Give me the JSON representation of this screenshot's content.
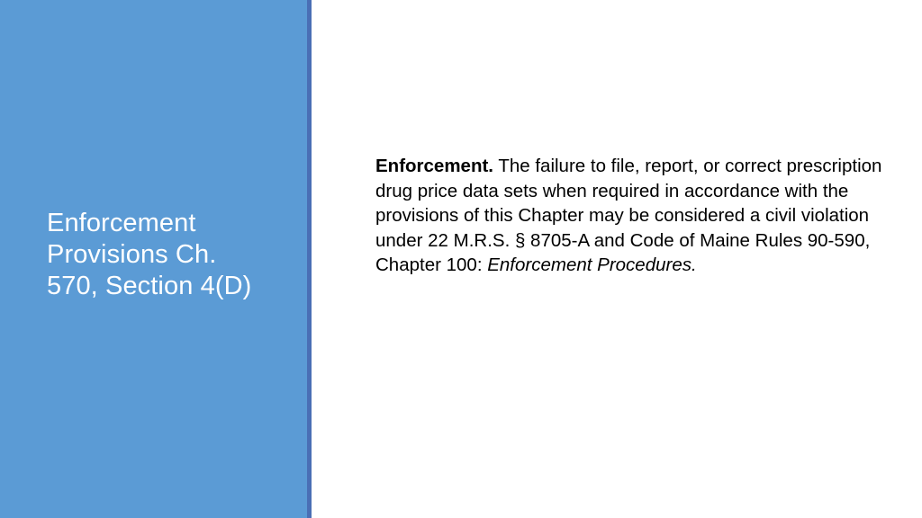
{
  "slide": {
    "title": {
      "lines": [
        "Enforcement",
        "Provisions Ch.",
        "570, Section 4(D)"
      ]
    },
    "body": {
      "lead_in": "Enforcement.",
      "text_before_citation": " The failure to file, report, or correct prescription drug price data sets when required in accordance with the provisions of this Chapter may be considered a civil violation under 22 M.R.S. § 8705-A and Code of Maine Rules 90-590, Chapter 100: ",
      "citation_italic": "Enforcement Procedures."
    },
    "colors": {
      "panel_blue": "#5b9bd5",
      "panel_stripe_blue": "#4a6fb5",
      "title_text": "#ffffff",
      "body_text": "#000000",
      "background": "#ffffff"
    }
  }
}
